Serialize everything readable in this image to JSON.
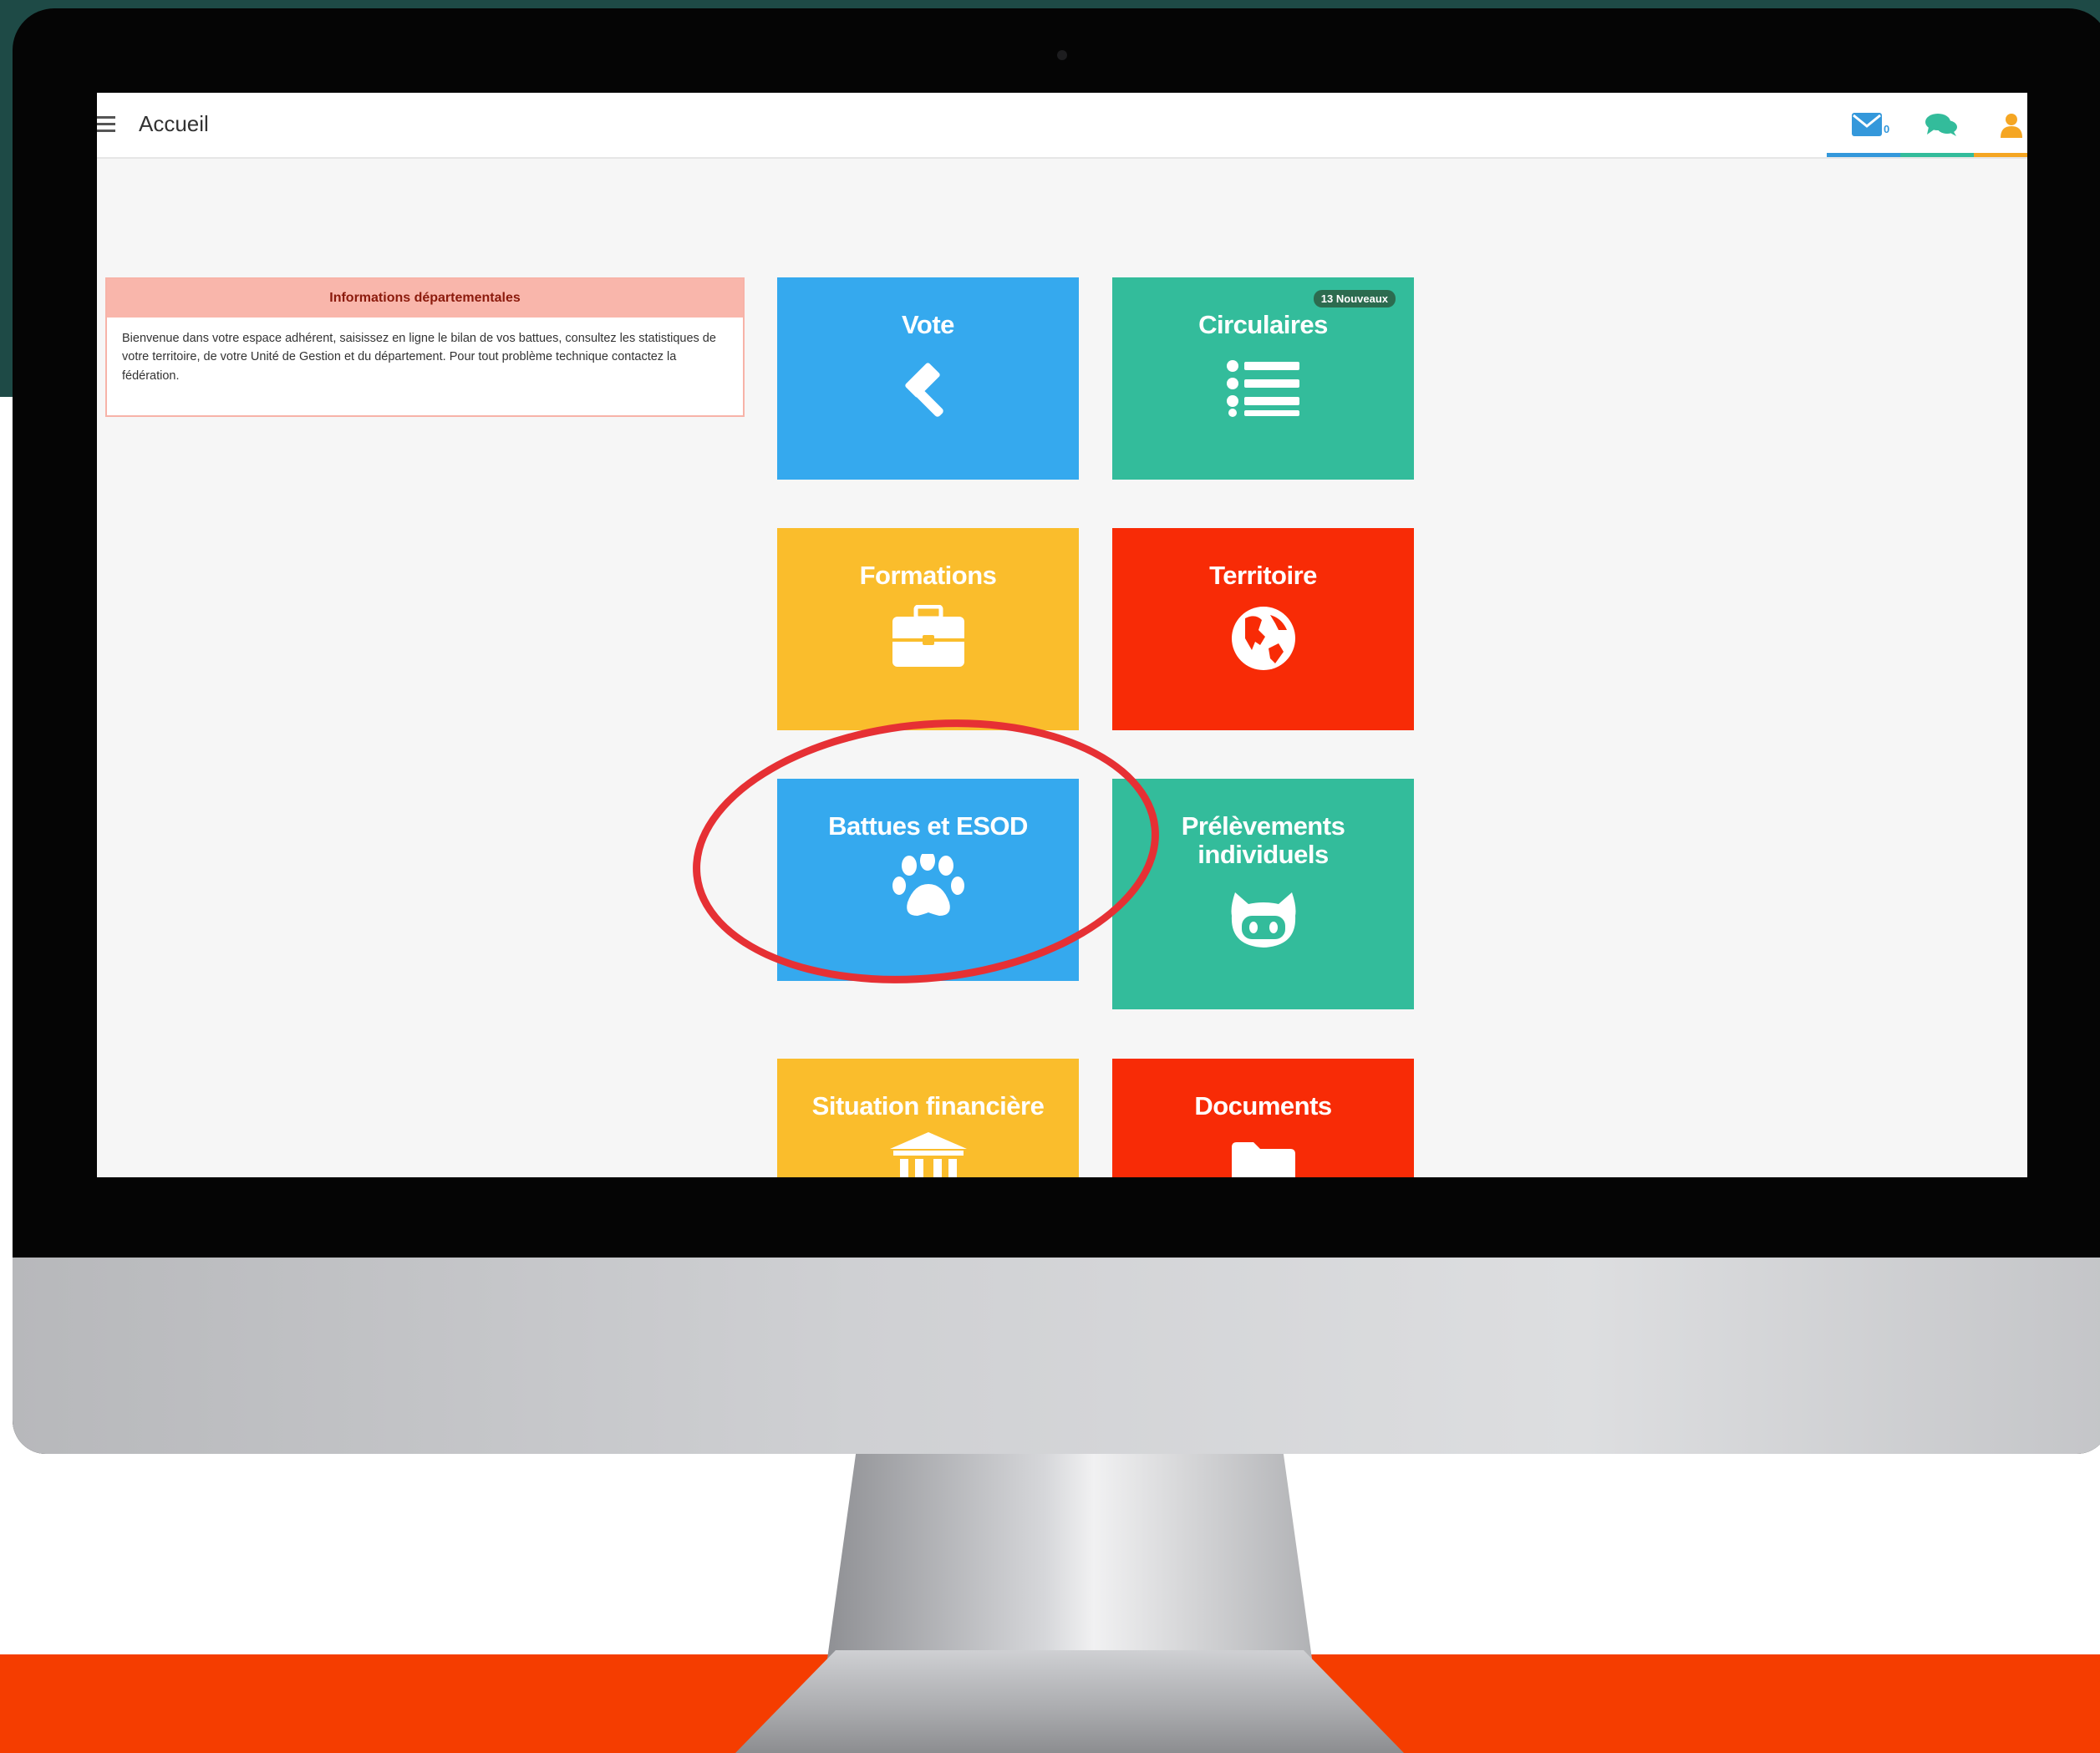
{
  "page": {
    "title": "Accueil"
  },
  "header": {
    "messages": {
      "count": "0",
      "icon": "envelope-icon"
    },
    "chat": {
      "icon": "comments-icon"
    },
    "user": {
      "icon": "user-icon"
    }
  },
  "info_panel": {
    "title": "Informations départementales",
    "body": "Bienvenue dans votre espace adhérent, saisissez en ligne le bilan de vos battues, consultez les statistiques de votre territoire, de votre Unité de Gestion et du département. Pour tout problème technique contactez la fédération."
  },
  "tiles": [
    {
      "label": "Vote",
      "icon": "gavel-icon",
      "color": "#35a9ee"
    },
    {
      "label": "Circulaires",
      "icon": "list-icon",
      "color": "#33bc9b",
      "badge": "13 Nouveaux"
    },
    {
      "label": "Formations",
      "icon": "briefcase-icon",
      "color": "#fabd2c"
    },
    {
      "label": "Territoire",
      "icon": "globe-icon",
      "color": "#f82b06"
    },
    {
      "label": "Battues et ESOD",
      "icon": "paw-icon",
      "color": "#35a9ee"
    },
    {
      "label": "Prélèvements individuels",
      "icon": "github-cat-icon",
      "color": "#33bc9b"
    },
    {
      "label": "Situation financière",
      "icon": "bank-icon",
      "color": "#fabd2c"
    },
    {
      "label": "Documents",
      "icon": "folder-icon",
      "color": "#f82b06"
    }
  ],
  "colors": {
    "background_top": "#1e4a46",
    "background_bottom": "#f53d00",
    "highlight": "#e63034",
    "nav_blue": "#3498db",
    "nav_green": "#33bc9b",
    "nav_orange": "#f5a623"
  }
}
